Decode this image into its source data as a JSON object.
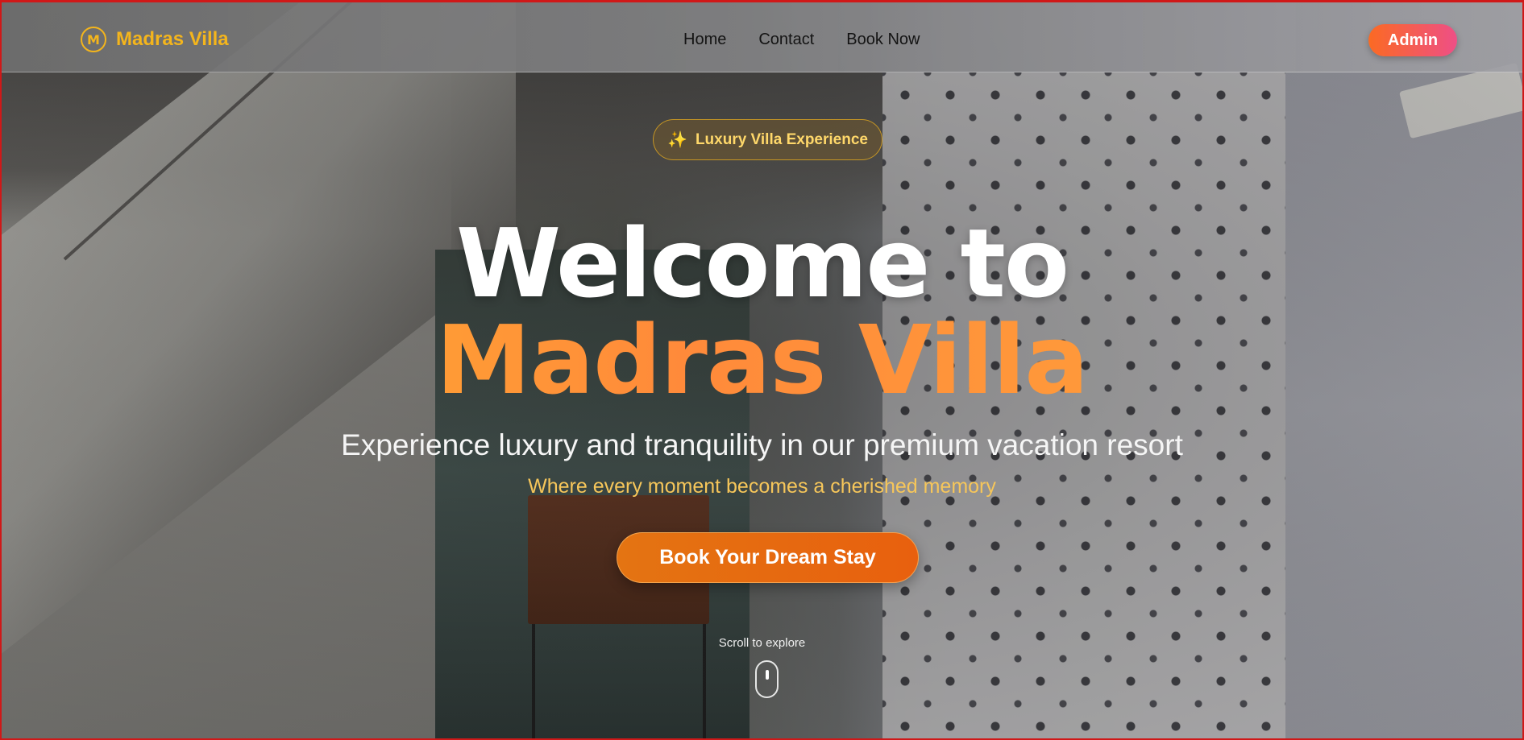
{
  "navbar": {
    "brand_logo_glyph": "M",
    "brand_name": "Madras Villa",
    "links": [
      {
        "label": "Home"
      },
      {
        "label": "Contact"
      },
      {
        "label": "Book Now"
      }
    ],
    "admin_label": "Admin"
  },
  "hero": {
    "badge_icon": "sparkles-icon",
    "badge_icon_glyph": "✨",
    "badge_label": "Luxury Villa Experience",
    "title_line1": "Welcome to",
    "title_line2": "Madras Villa",
    "subtitle": "Experience luxury and tranquility in our premium vacation resort",
    "tagline": "Where every moment becomes a cherished memory",
    "cta_label": "Book Your Dream Stay",
    "scroll_label": "Scroll to explore"
  },
  "colors": {
    "brand_gold": "#f4b51c",
    "accent_orange": "#e8600e",
    "admin_gradient_start": "#fb6a23",
    "admin_gradient_end": "#ee4f86",
    "tagline": "#f6c65a"
  }
}
